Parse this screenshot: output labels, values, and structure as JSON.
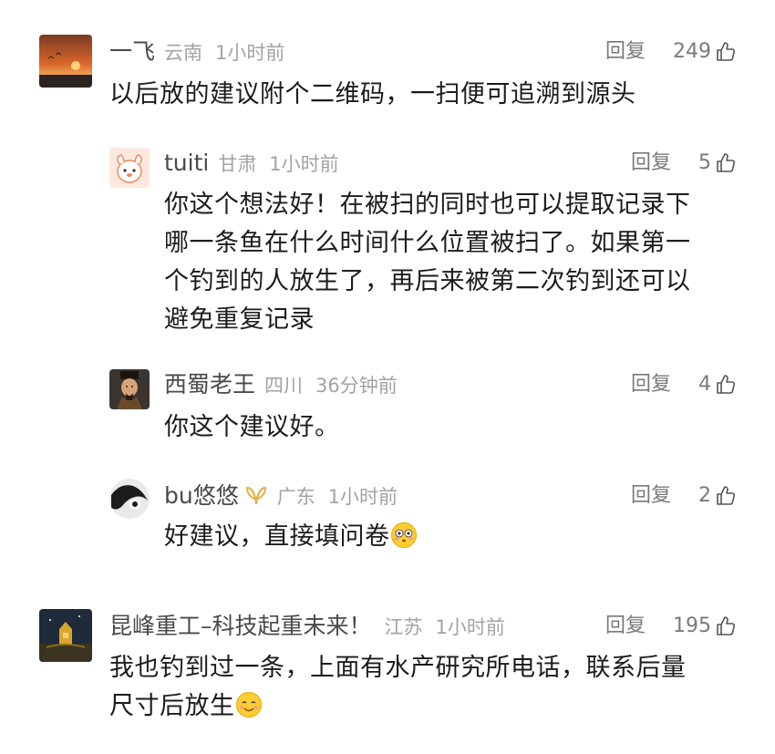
{
  "comments": [
    {
      "name": "一飞",
      "region": "云南",
      "time": "1小时前",
      "reply_label": "回复",
      "likes": "249",
      "text": "以后放的建议附个二维码，一扫便可追溯到源头"
    },
    {
      "name": "tuiti",
      "region": "甘肃",
      "time": "1小时前",
      "reply_label": "回复",
      "likes": "5",
      "lines": [
        "你这个想法好！在被扫的同时也可以提取记录下",
        "哪一条鱼在什么时间什么位置被扫了。如果第一",
        "个钓到的人放生了，再后来被第二次钓到还可以",
        "避免重复记录"
      ]
    },
    {
      "name": "西蜀老王",
      "region": "四川",
      "time": "36分钟前",
      "reply_label": "回复",
      "likes": "4",
      "text": "你这个建议好。"
    },
    {
      "name": "bu悠悠",
      "region": "广东",
      "time": "1小时前",
      "reply_label": "回复",
      "likes": "2",
      "text": "好建议，直接填问卷"
    },
    {
      "name": "昆峰重工–科技起重未来！",
      "region": "江苏",
      "time": "1小时前",
      "reply_label": "回复",
      "likes": "195",
      "lines": [
        "我也钓到过一条，上面有水产研究所电话，联系后量",
        "尺寸后放生"
      ]
    }
  ],
  "colors": {
    "name": "#4a4a4a",
    "meta": "#a3a3a3",
    "action": "#7a7a7a",
    "body": "#1c1c1c",
    "vip_badge": "#e8b04a"
  },
  "icons": [
    "thumbs-up-icon",
    "vip-badge-icon",
    "flushed-face-emoji",
    "smile-face-emoji"
  ]
}
